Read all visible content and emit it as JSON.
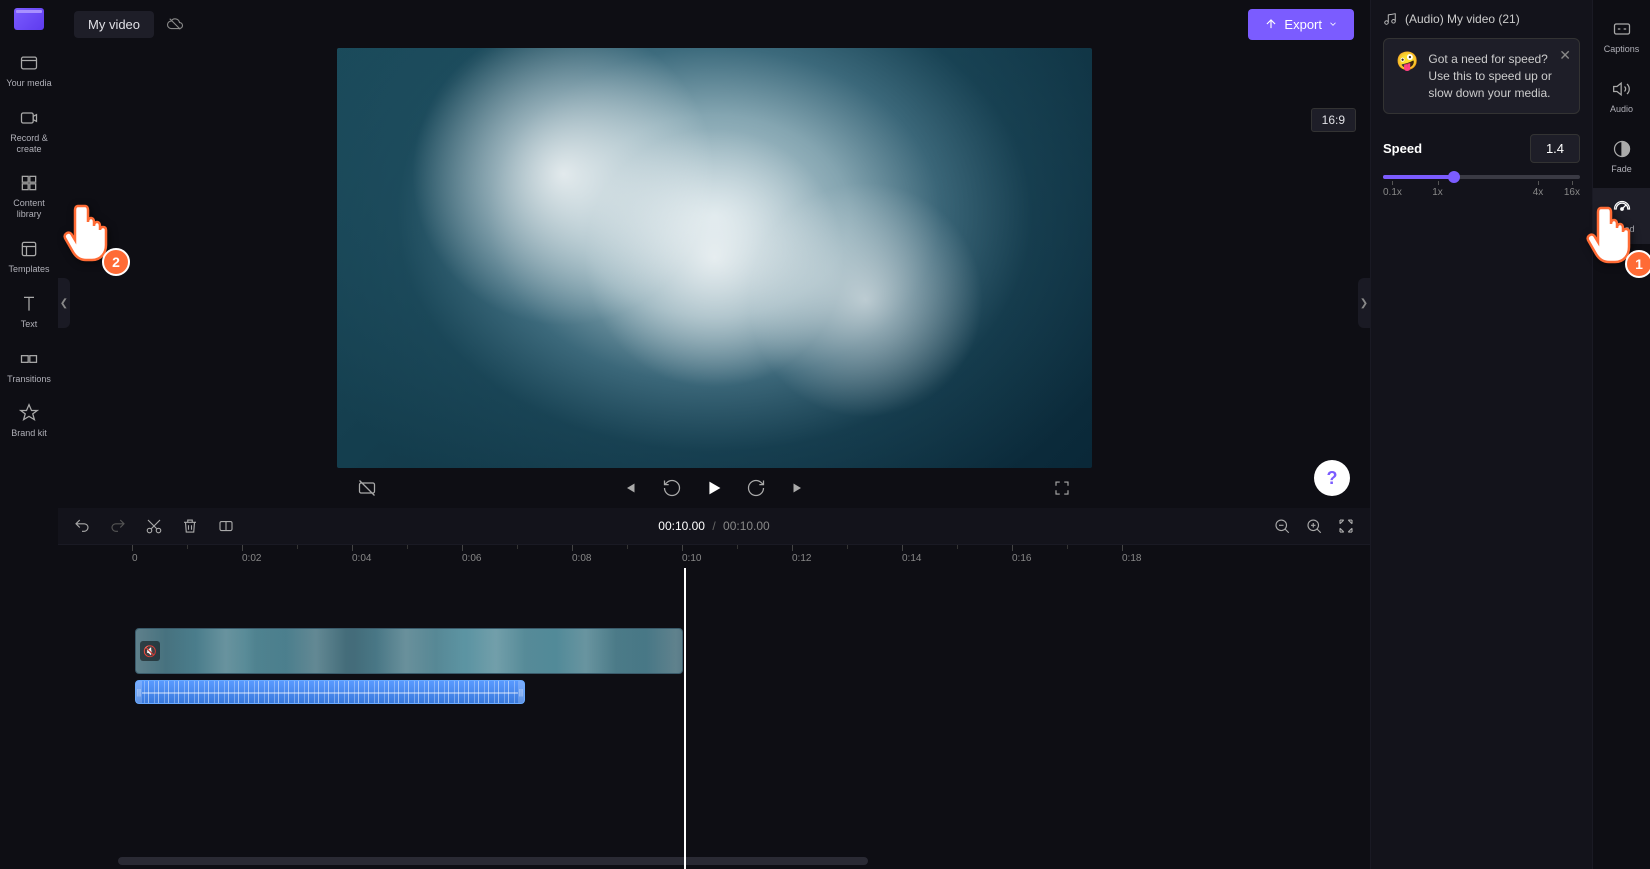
{
  "project_title": "My video",
  "export_label": "Export",
  "aspect_ratio": "16:9",
  "left_sidebar": [
    {
      "label": "Your media",
      "icon": "media-icon"
    },
    {
      "label": "Record & create",
      "icon": "record-icon"
    },
    {
      "label": "Content library",
      "icon": "library-icon"
    },
    {
      "label": "Templates",
      "icon": "templates-icon"
    },
    {
      "label": "Text",
      "icon": "text-icon"
    },
    {
      "label": "Transitions",
      "icon": "transitions-icon"
    },
    {
      "label": "Brand kit",
      "icon": "brand-icon"
    }
  ],
  "right_sidebar": [
    {
      "label": "Captions",
      "icon": "captions-icon"
    },
    {
      "label": "Audio",
      "icon": "audio-icon"
    },
    {
      "label": "Fade",
      "icon": "fade-icon"
    },
    {
      "label": "Speed",
      "icon": "speed-icon"
    }
  ],
  "audio_info": "(Audio) My video (21)",
  "tip": {
    "emoji": "🤪",
    "text": "Got a need for speed? Use this to speed up or slow down your media."
  },
  "speed": {
    "label": "Speed",
    "value": "1.4",
    "ticks": [
      "0.1x",
      "1x",
      "4x",
      "16x"
    ]
  },
  "time": {
    "current": "00:10.00",
    "total": "00:10.00"
  },
  "ruler": [
    "0",
    "0:02",
    "0:04",
    "0:06",
    "0:08",
    "0:10",
    "0:12",
    "0:14",
    "0:16",
    "0:18"
  ],
  "hand_annotations": [
    {
      "number": "1",
      "position": "right_sidebar_speed"
    },
    {
      "number": "2",
      "position": "speed_slider"
    }
  ]
}
